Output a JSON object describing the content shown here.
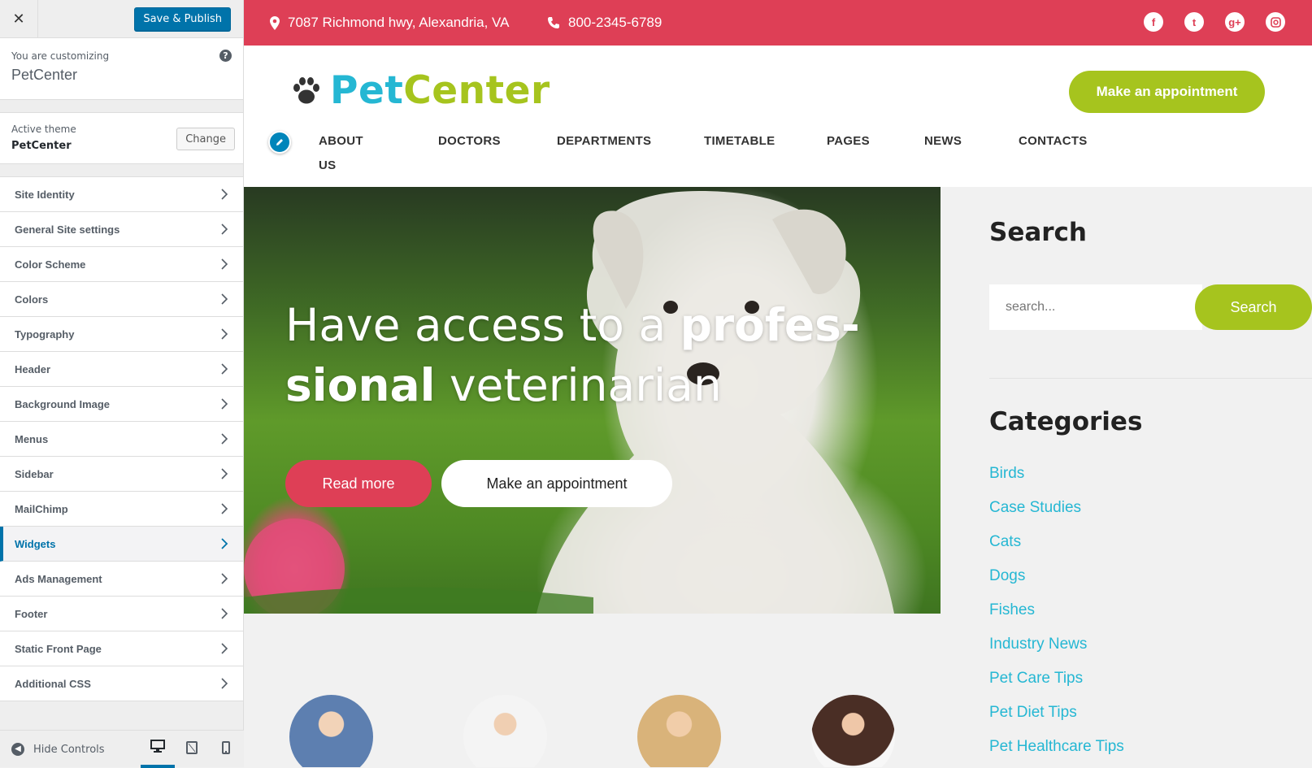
{
  "customizer": {
    "close_label": "✕",
    "save_label": "Save & Publish",
    "customizing_label": "You are customizing",
    "site_name": "PetCenter",
    "active_theme_label": "Active theme",
    "active_theme_name": "PetCenter",
    "change_label": "Change",
    "sections": [
      {
        "label": "Site Identity"
      },
      {
        "label": "General Site settings"
      },
      {
        "label": "Color Scheme"
      },
      {
        "label": "Colors"
      },
      {
        "label": "Typography"
      },
      {
        "label": "Header"
      },
      {
        "label": "Background Image"
      },
      {
        "label": "Menus"
      },
      {
        "label": "Sidebar"
      },
      {
        "label": "MailChimp"
      },
      {
        "label": "Widgets",
        "active": true
      },
      {
        "label": "Ads Management"
      },
      {
        "label": "Footer"
      },
      {
        "label": "Static Front Page"
      },
      {
        "label": "Additional CSS"
      }
    ],
    "hide_controls_label": "Hide Controls",
    "devices": [
      "desktop-icon",
      "tablet-icon",
      "mobile-icon"
    ],
    "active_device": "desktop",
    "accent_color": "#0073aa"
  },
  "site": {
    "topbar": {
      "address": "7087 Richmond hwy, Alexandria, VA",
      "phone": "800-2345-6789",
      "social": [
        "facebook-icon",
        "twitter-icon",
        "google-plus-icon",
        "instagram-icon"
      ],
      "background": "#de3f56"
    },
    "logo": {
      "part1": "Pet",
      "part2": "Center"
    },
    "header_button": "Make an appointment",
    "nav": [
      "ABOUT US",
      "DOCTORS",
      "DEPARTMENTS",
      "TIMETABLE",
      "PAGES",
      "NEWS",
      "CONTACTS"
    ],
    "hero": {
      "line1": "Have access to a ",
      "line1_bold": "profes-",
      "line2_bold": "sional",
      "line2": " veterinarian",
      "btn_read": "Read more",
      "btn_appointment": "Make an appointment"
    },
    "sidebar": {
      "search_title": "Search",
      "search_placeholder": "search...",
      "search_button": "Search",
      "categories_title": "Categories",
      "categories": [
        "Birds",
        "Case Studies",
        "Cats",
        "Dogs",
        "Fishes",
        "Industry News",
        "Pet Care Tips",
        "Pet Diet Tips",
        "Pet Healthcare Tips"
      ]
    },
    "colors": {
      "pink": "#de3f56",
      "green": "#a6c41e",
      "blue": "#25b7d3"
    }
  }
}
